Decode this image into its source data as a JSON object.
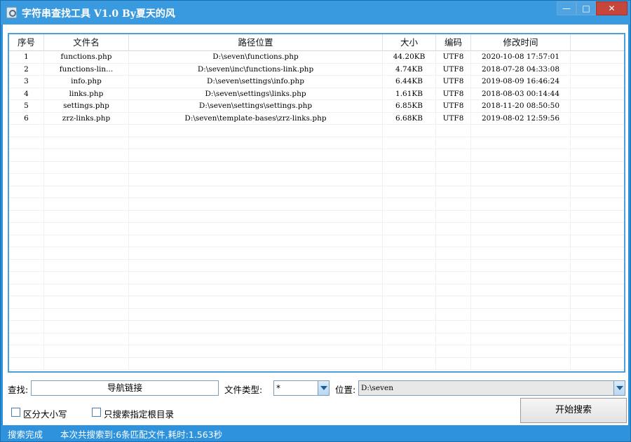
{
  "window": {
    "title": "字符串查找工具 V1.0 By夏天的风",
    "min_glyph": "—",
    "max_glyph": "□",
    "close_glyph": "✕"
  },
  "table": {
    "headers": [
      "序号",
      "文件名",
      "路径位置",
      "大小",
      "编码",
      "修改时间"
    ],
    "rows": [
      {
        "no": "1",
        "name": "functions.php",
        "path": "D:\\seven\\functions.php",
        "size": "44.20KB",
        "enc": "UTF8",
        "mtime": "2020-10-08 17:57:01"
      },
      {
        "no": "2",
        "name": "functions-lin...",
        "path": "D:\\seven\\inc\\functions-link.php",
        "size": "4.74KB",
        "enc": "UTF8",
        "mtime": "2018-07-28 04:33:08"
      },
      {
        "no": "3",
        "name": "info.php",
        "path": "D:\\seven\\settings\\info.php",
        "size": "6.44KB",
        "enc": "UTF8",
        "mtime": "2019-08-09 16:46:24"
      },
      {
        "no": "4",
        "name": "links.php",
        "path": "D:\\seven\\settings\\links.php",
        "size": "1.61KB",
        "enc": "UTF8",
        "mtime": "2018-08-03 00:14:44"
      },
      {
        "no": "5",
        "name": "settings.php",
        "path": "D:\\seven\\settings\\settings.php",
        "size": "6.85KB",
        "enc": "UTF8",
        "mtime": "2018-11-20 08:50:50"
      },
      {
        "no": "6",
        "name": "zrz-links.php",
        "path": "D:\\seven\\template-bases\\zrz-links.php",
        "size": "6.68KB",
        "enc": "UTF8",
        "mtime": "2019-08-02 12:59:56"
      }
    ]
  },
  "search": {
    "label": "查找:",
    "value": "导航链接",
    "filetype_label": "文件类型:",
    "filetype_value": "*",
    "location_label": "位置:",
    "location_value": "D:\\seven"
  },
  "options": {
    "case_sensitive": "区分大小写",
    "root_only": "只搜索指定根目录"
  },
  "start_button": "开始搜索",
  "status": {
    "state": "搜索完成",
    "summary": "本次共搜索到:6条匹配文件,耗时:1.563秒"
  }
}
